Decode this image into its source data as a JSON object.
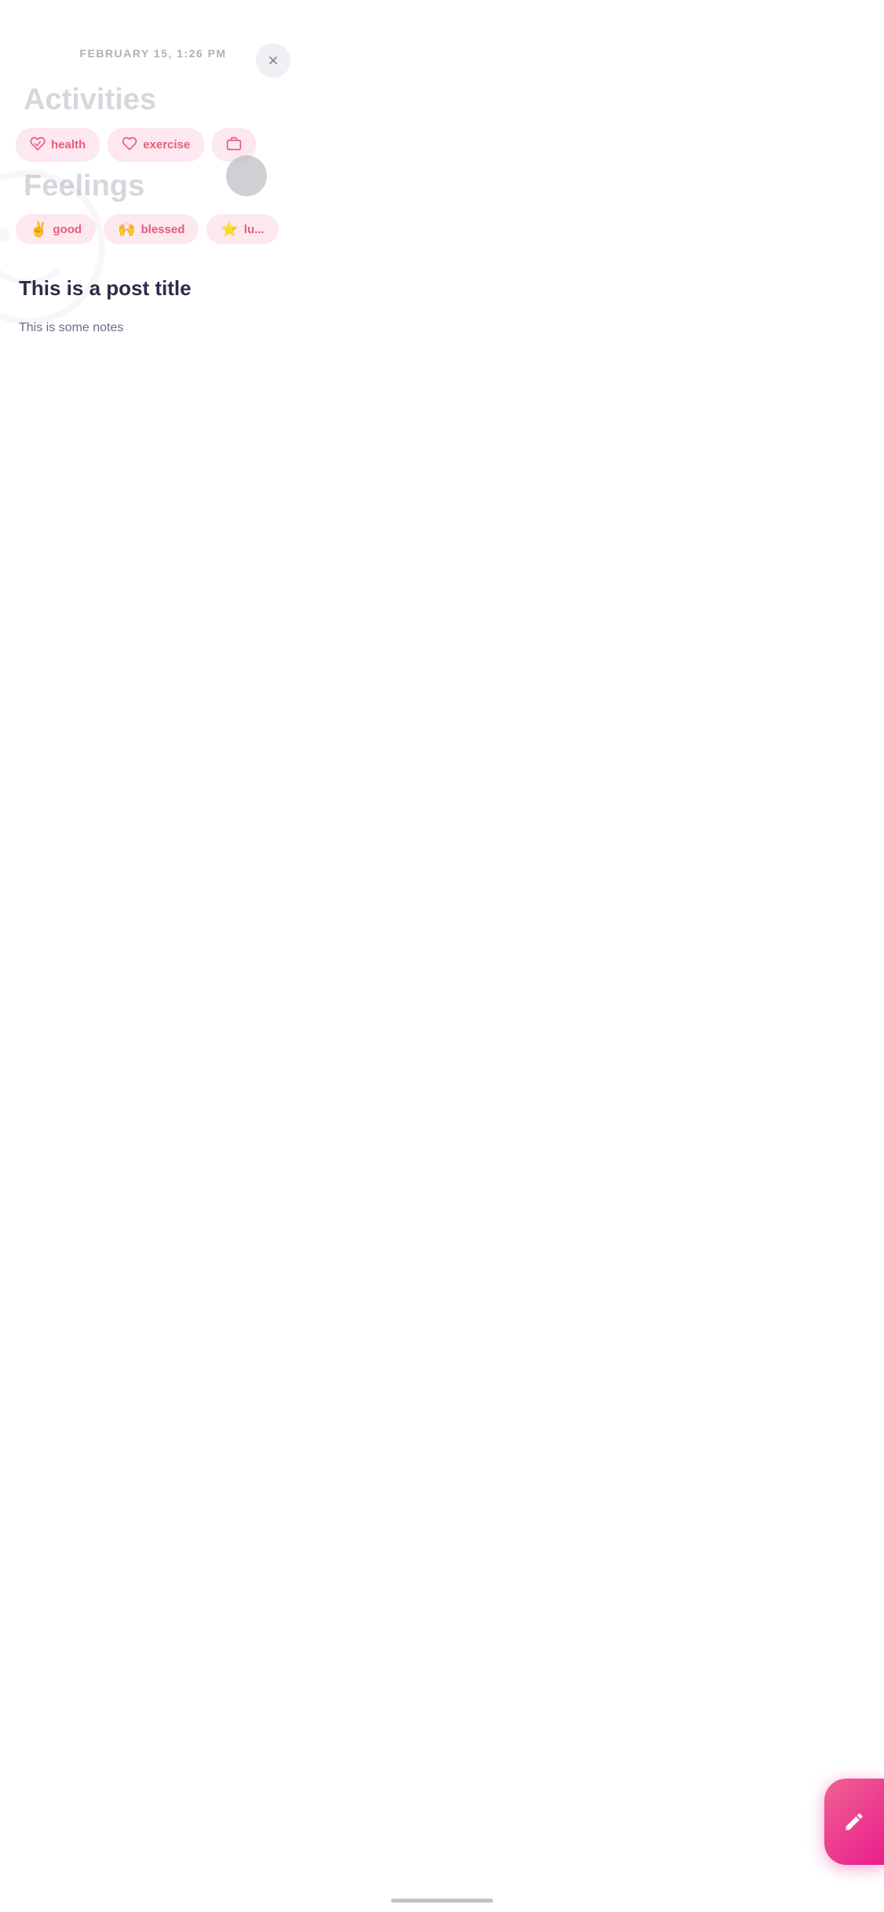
{
  "header": {
    "date": "FEBRUARY 15,  1:26 PM",
    "close_label": "close"
  },
  "activities": {
    "section_title": "Activities",
    "tags": [
      {
        "id": "health",
        "label": "health",
        "icon": "💗"
      },
      {
        "id": "exercise",
        "label": "exercise",
        "icon": "👟"
      },
      {
        "id": "work",
        "label": "work",
        "icon": "💼"
      }
    ]
  },
  "feelings": {
    "section_title": "Feelings",
    "tags": [
      {
        "id": "good",
        "label": "good",
        "icon": "✌️"
      },
      {
        "id": "blessed",
        "label": "blessed",
        "icon": "🙌"
      },
      {
        "id": "lucky",
        "label": "lu...",
        "icon": "⭐"
      }
    ]
  },
  "post": {
    "title": "This is a post title",
    "notes": "This is some notes"
  },
  "fab": {
    "label": "edit",
    "icon": "edit-icon"
  },
  "colors": {
    "accent": "#e91e8c",
    "tag_bg": "#fce8ee",
    "tag_text": "#e85c7a"
  }
}
